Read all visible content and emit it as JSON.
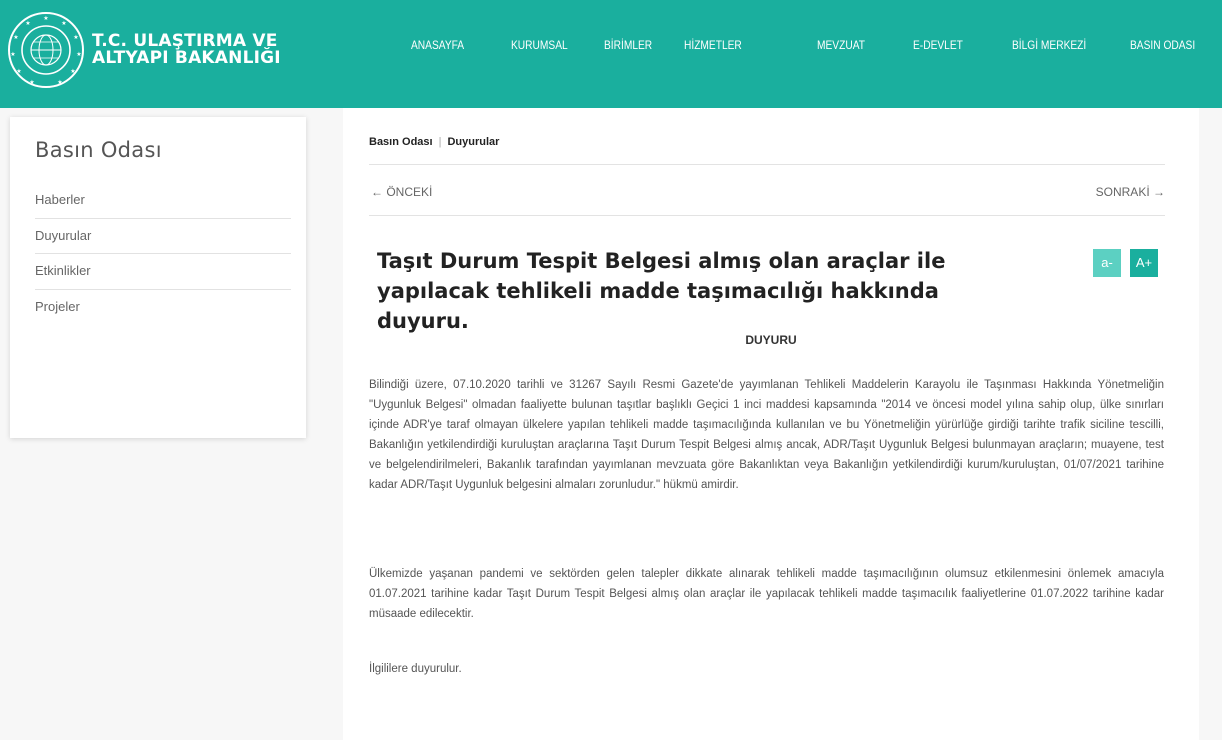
{
  "header": {
    "logo_line1": "T.C. ULAŞTIRMA VE",
    "logo_line2": "ALTYAPI BAKANLIĞI",
    "brand_color": "#1aaf9e",
    "nav": [
      "ANASAYFA",
      "KURUMSAL",
      "BİRİMLER",
      "HİZMETLER",
      "MEVZUAT",
      "E-DEVLET",
      "BİLGİ MERKEZİ",
      "BASIN ODASI"
    ]
  },
  "sidebar": {
    "title": "Basın Odası",
    "items": [
      "Haberler",
      "Duyurular",
      "Etkinlikler",
      "Projeler"
    ]
  },
  "main": {
    "breadcrumb": [
      "Basın Odası",
      "Duyurular"
    ],
    "breadcrumb_sep": "|",
    "prev_label": "←  ÖNCEKİ",
    "next_label": "SONRAKİ  →",
    "title": "Taşıt Durum Tespit Belgesi almış olan araçlar ile yapılacak tehlikeli madde taşımacılığı hakkında duyuru.",
    "font_minus_label": "a-",
    "font_plus_label": "A+",
    "heading": "DUYURU",
    "paragraphs": [
      "Bilindiği üzere, 07.10.2020 tarihli ve 31267 Sayılı Resmi Gazete'de yayımlanan Tehlikeli Maddelerin Karayolu ile Taşınması Hakkında Yönetmeliğin \"Uygunluk Belgesi\" olmadan faaliyette bulunan taşıtlar başlıklı Geçici 1 inci maddesi kapsamında \"2014 ve öncesi model yılına sahip olup, ülke sınırları içinde ADR'ye taraf olmayan ülkelere yapılan tehlikeli madde taşımacılığında kullanılan ve bu Yönetmeliğin yürürlüğe girdiği tarihte trafik siciline tescilli, Bakanlığın yetkilendirdiği kuruluştan araçlarına Taşıt Durum Tespit Belgesi almış ancak, ADR/Taşıt Uygunluk Belgesi bulunmayan araçların; muayene, test ve belgelendirilmeleri, Bakanlık tarafından yayımlanan mevzuata göre Bakanlıktan veya Bakanlığın yetkilendirdiği kurum/kuruluştan, 01/07/2021 tarihine kadar ADR/Taşıt Uygunluk belgesini almaları zorunludur.\" hükmü amirdir.",
      "Ülkemizde yaşanan pandemi ve sektörden gelen talepler dikkate alınarak tehlikeli madde taşımacılığının olumsuz etkilenmesini önlemek amacıyla 01.07.2021 tarihine kadar Taşıt Durum Tespit Belgesi almış olan araçlar ile yapılacak tehlikeli madde taşımacılık faaliyetlerine 01.07.2022 tarihine kadar müsaade edilecektir.",
      "İlgililere duyurulur."
    ]
  }
}
